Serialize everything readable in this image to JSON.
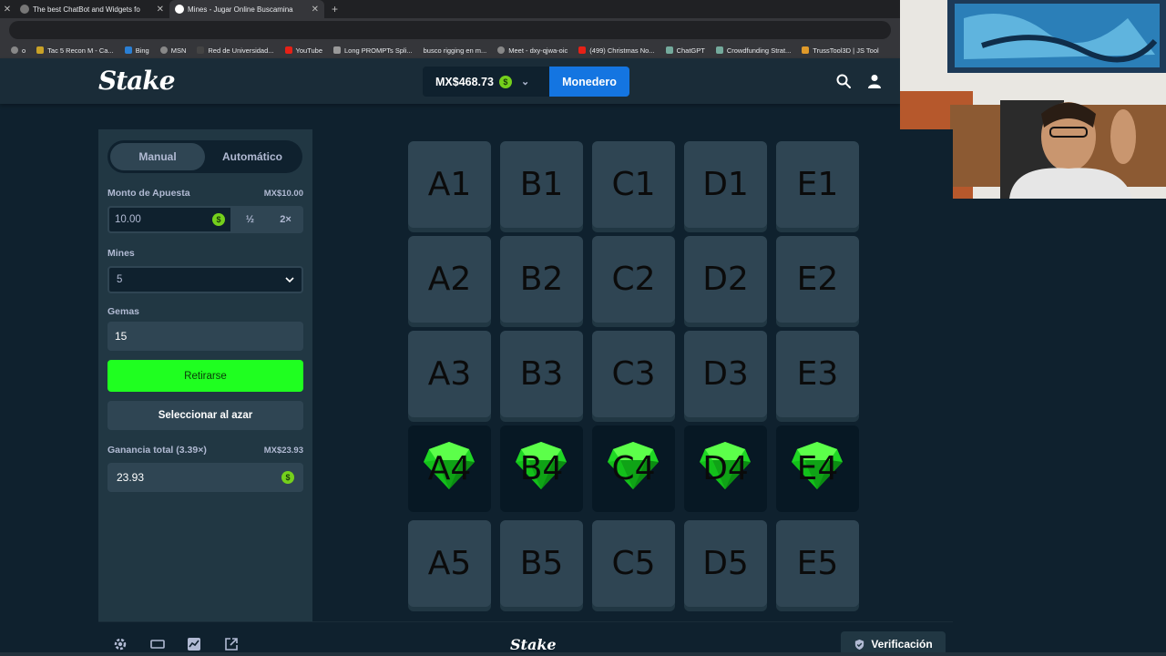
{
  "browser": {
    "tabs": [
      {
        "title": "The best ChatBot and Widgets fo",
        "active": false
      },
      {
        "title": "Mines - Jugar Online Buscamina",
        "active": true
      }
    ],
    "bookmarks": [
      "o",
      "Tac 5 Recon M - Ca...",
      "Bing",
      "MSN",
      "Red de Universidad...",
      "YouTube",
      "Long PROMPTs Spli...",
      "busco rigging en m...",
      "Meet - dxy-qjwa-oic",
      "(499) Christmas No...",
      "ChatGPT",
      "Crowdfunding Strat...",
      "TrussTool3D | JS Tool"
    ]
  },
  "header": {
    "logo": "Stake",
    "balance": "MX$468.73",
    "wallet_label": "Monedero"
  },
  "sidebar": {
    "mode_manual": "Manual",
    "mode_auto": "Automático",
    "bet_label": "Monto de Apuesta",
    "bet_display": "MX$10.00",
    "bet_value": "10.00",
    "half_label": "½",
    "double_label": "2×",
    "mines_label": "Mines",
    "mines_value": "5",
    "gems_label": "Gemas",
    "gems_value": "15",
    "cashout_label": "Retirarse",
    "random_label": "Seleccionar al azar",
    "profit_label": "Ganancia total (3.39×)",
    "profit_display": "MX$23.93",
    "profit_value": "23.93"
  },
  "grid": {
    "tiles": [
      {
        "code": "A1",
        "revealed": false
      },
      {
        "code": "B1",
        "revealed": false
      },
      {
        "code": "C1",
        "revealed": false
      },
      {
        "code": "D1",
        "revealed": false
      },
      {
        "code": "E1",
        "revealed": false
      },
      {
        "code": "A2",
        "revealed": false
      },
      {
        "code": "B2",
        "revealed": false
      },
      {
        "code": "C2",
        "revealed": false
      },
      {
        "code": "D2",
        "revealed": false
      },
      {
        "code": "E2",
        "revealed": false
      },
      {
        "code": "A3",
        "revealed": false
      },
      {
        "code": "B3",
        "revealed": false
      },
      {
        "code": "C3",
        "revealed": false
      },
      {
        "code": "D3",
        "revealed": false
      },
      {
        "code": "E3",
        "revealed": false
      },
      {
        "code": "A4",
        "revealed": true
      },
      {
        "code": "B4",
        "revealed": true
      },
      {
        "code": "C4",
        "revealed": true
      },
      {
        "code": "D4",
        "revealed": true
      },
      {
        "code": "E4",
        "revealed": true
      },
      {
        "code": "A5",
        "revealed": false
      },
      {
        "code": "B5",
        "revealed": false
      },
      {
        "code": "C5",
        "revealed": false
      },
      {
        "code": "D5",
        "revealed": false
      },
      {
        "code": "E5",
        "revealed": false
      }
    ]
  },
  "footer": {
    "logo": "Stake",
    "verify_label": "Verificación"
  },
  "colors": {
    "accent_green": "#1fff20",
    "wallet_blue": "#1475e1",
    "gem_green": "#1fd624",
    "bg_dark": "#0f212e",
    "panel": "#213743"
  },
  "icons": [
    "search-icon",
    "user-icon",
    "settings-icon",
    "theatre-mode-icon",
    "stats-icon",
    "popout-icon",
    "shield-check-icon",
    "gem-icon",
    "coin-icon"
  ]
}
